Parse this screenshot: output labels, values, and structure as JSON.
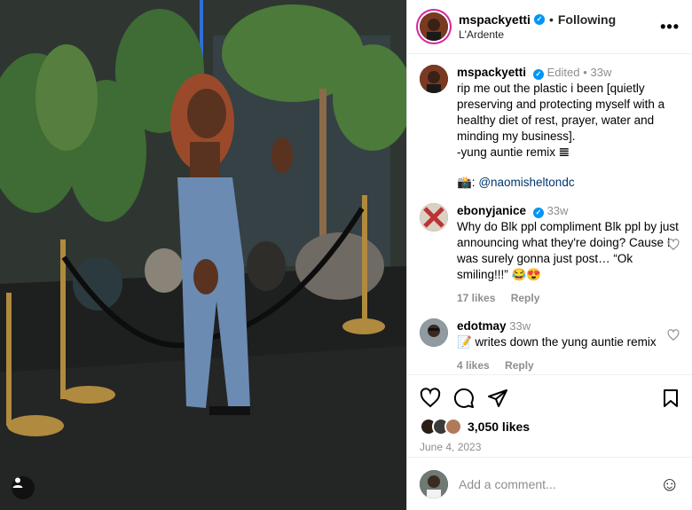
{
  "post": {
    "author": "mspackyetti",
    "location": "L'Ardente",
    "follow_status": "Following",
    "separator": "•",
    "more_label": "•••"
  },
  "caption": {
    "user": "mspackyetti",
    "edited": "Edited",
    "time": "33w",
    "text": "rip me out the plastic i been [quietly preserving and protecting myself with a healthy diet of rest, prayer, water and minding my business].\n-yung auntie remix 𝌆",
    "credit_prefix": "📸: ",
    "credit_mention": "@naomisheltondc"
  },
  "comments": [
    {
      "user": "ebonyjanice",
      "time": "33w",
      "text": "Why do Blk ppl compliment Blk ppl by just announcing what they're doing? Cause I was surely gonna just post… “Ok smiling!!!” 😂😍",
      "likes": "17 likes",
      "reply": "Reply"
    },
    {
      "user": "edotmay",
      "time": "33w",
      "text": "📝 writes down the yung auntie remix",
      "likes": "4 likes",
      "reply": "Reply"
    }
  ],
  "stats": {
    "likes": "3,050 likes",
    "date": "June 4, 2023"
  },
  "add_comment": {
    "placeholder": "Add a comment...",
    "emoji": "☺"
  },
  "colors": {
    "accent": "#0095f6",
    "muted": "#8e8e8e",
    "story_ring": "#d6249f"
  },
  "icons": [
    "heart-icon",
    "comment-icon",
    "share-icon",
    "save-icon",
    "emoji-icon",
    "user-tag-icon",
    "verified-icon",
    "more-icon"
  ]
}
